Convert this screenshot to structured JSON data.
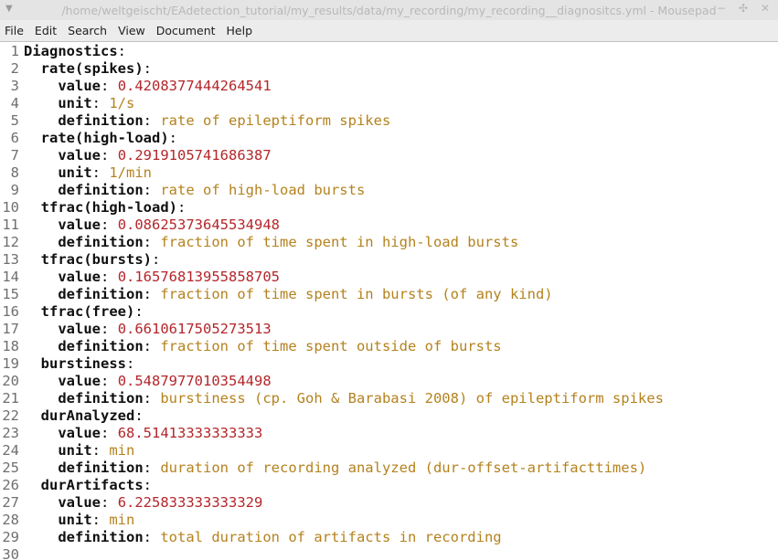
{
  "window": {
    "title": "/home/weltgeischt/EAdetection_tutorial/my_results/data/my_recording/my_recording__diagnositcs.yml - Mousepad"
  },
  "menubar": [
    "File",
    "Edit",
    "Search",
    "View",
    "Document",
    "Help"
  ],
  "colors": {
    "key": "#101010",
    "number": "#b4262a",
    "string": "#b4821e",
    "line_number": "#6f6f6f"
  },
  "editor": {
    "lines": [
      {
        "n": "1",
        "indent": "",
        "key": "Diagnostics",
        "value": "",
        "vtype": ""
      },
      {
        "n": "2",
        "indent": "  ",
        "key": "rate(spikes)",
        "value": "",
        "vtype": ""
      },
      {
        "n": "3",
        "indent": "    ",
        "key": "value",
        "value": "0.4208377444264541",
        "vtype": "num"
      },
      {
        "n": "4",
        "indent": "    ",
        "key": "unit",
        "value": "1/s",
        "vtype": "str"
      },
      {
        "n": "5",
        "indent": "    ",
        "key": "definition",
        "value": "rate of epileptiform spikes",
        "vtype": "str"
      },
      {
        "n": "6",
        "indent": "  ",
        "key": "rate(high-load)",
        "value": "",
        "vtype": ""
      },
      {
        "n": "7",
        "indent": "    ",
        "key": "value",
        "value": "0.2919105741686387",
        "vtype": "num"
      },
      {
        "n": "8",
        "indent": "    ",
        "key": "unit",
        "value": "1/min",
        "vtype": "str"
      },
      {
        "n": "9",
        "indent": "    ",
        "key": "definition",
        "value": "rate of high-load bursts",
        "vtype": "str"
      },
      {
        "n": "10",
        "indent": "  ",
        "key": "tfrac(high-load)",
        "value": "",
        "vtype": ""
      },
      {
        "n": "11",
        "indent": "    ",
        "key": "value",
        "value": "0.08625373645534948",
        "vtype": "num"
      },
      {
        "n": "12",
        "indent": "    ",
        "key": "definition",
        "value": "fraction of time spent in high-load bursts",
        "vtype": "str"
      },
      {
        "n": "13",
        "indent": "  ",
        "key": "tfrac(bursts)",
        "value": "",
        "vtype": ""
      },
      {
        "n": "14",
        "indent": "    ",
        "key": "value",
        "value": "0.16576813955858705",
        "vtype": "num"
      },
      {
        "n": "15",
        "indent": "    ",
        "key": "definition",
        "value": "fraction of time spent in bursts (of any kind)",
        "vtype": "str"
      },
      {
        "n": "16",
        "indent": "  ",
        "key": "tfrac(free)",
        "value": "",
        "vtype": ""
      },
      {
        "n": "17",
        "indent": "    ",
        "key": "value",
        "value": "0.6610617505273513",
        "vtype": "num"
      },
      {
        "n": "18",
        "indent": "    ",
        "key": "definition",
        "value": "fraction of time spent outside of bursts",
        "vtype": "str"
      },
      {
        "n": "19",
        "indent": "  ",
        "key": "burstiness",
        "value": "",
        "vtype": ""
      },
      {
        "n": "20",
        "indent": "    ",
        "key": "value",
        "value": "0.5487977010354498",
        "vtype": "num"
      },
      {
        "n": "21",
        "indent": "    ",
        "key": "definition",
        "value": "burstiness (cp. Goh & Barabasi 2008) of epileptiform spikes",
        "vtype": "str"
      },
      {
        "n": "22",
        "indent": "  ",
        "key": "durAnalyzed",
        "value": "",
        "vtype": ""
      },
      {
        "n": "23",
        "indent": "    ",
        "key": "value",
        "value": "68.51413333333333",
        "vtype": "num"
      },
      {
        "n": "24",
        "indent": "    ",
        "key": "unit",
        "value": "min",
        "vtype": "str"
      },
      {
        "n": "25",
        "indent": "    ",
        "key": "definition",
        "value": "duration of recording analyzed (dur-offset-artifacttimes)",
        "vtype": "str"
      },
      {
        "n": "26",
        "indent": "  ",
        "key": "durArtifacts",
        "value": "",
        "vtype": ""
      },
      {
        "n": "27",
        "indent": "    ",
        "key": "value",
        "value": "6.225833333333329",
        "vtype": "num"
      },
      {
        "n": "28",
        "indent": "    ",
        "key": "unit",
        "value": "min",
        "vtype": "str"
      },
      {
        "n": "29",
        "indent": "    ",
        "key": "definition",
        "value": "total duration of artifacts in recording",
        "vtype": "str"
      },
      {
        "n": "30",
        "indent": "",
        "key": "",
        "value": "",
        "vtype": ""
      }
    ]
  }
}
